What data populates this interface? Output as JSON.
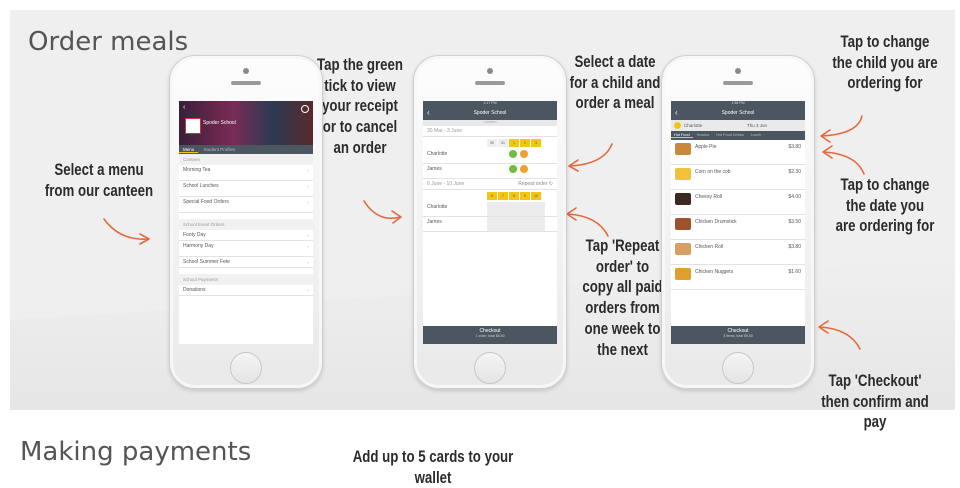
{
  "sections": {
    "order_heading": "Order meals",
    "payments_heading": "Making payments",
    "payments_caption": "Add up to 5 cards to your wallet"
  },
  "annotations": {
    "select_menu": "Select a menu\nfrom our canteen",
    "green_tick": "Tap the green\ntick to view\nyour receipt\nor to cancel\nan order",
    "select_date": "Select a date\nfor a child and\norder a meal",
    "repeat_order": "Tap 'Repeat\norder' to\ncopy all paid\norders from\none week to\nthe next",
    "change_child": "Tap to change\nthe child you are\nordering for",
    "change_date": "Tap to change\nthe date you\nare ordering for",
    "checkout": "Tap 'Checkout'\nthen confirm and pay"
  },
  "phone1": {
    "school_name": "Spoder School",
    "tabs": [
      "Menu",
      "Student Profiles"
    ],
    "section_canteen": "Canteen",
    "canteen_items": [
      "Morning Tea",
      "School Lunches",
      "Special Food Orders"
    ],
    "section_events": "School Event Orders",
    "event_items": [
      "Footy Day",
      "Harmony Day",
      "School Summer Fete"
    ],
    "section_payments": "School Payments",
    "payment_items": [
      "Donations"
    ]
  },
  "phone2": {
    "status_time": "2:17 PM",
    "title": "Spoder School",
    "subtitle": "Canteen",
    "week1": "30 Mar - 3 June",
    "week2": "6 June - 10 June",
    "students": [
      "Charlotte",
      "James"
    ],
    "repeat_label": "Repeat order",
    "checkout_label": "Checkout",
    "checkout_sub": "1 order, total $8.50"
  },
  "phone3": {
    "status_time": "1:58 PM",
    "title": "Spoder School",
    "child": "Charlotte",
    "date": "Thu 3 Jun",
    "tabs": [
      "Hot Food",
      "Snacks",
      "Hot Food Drinks",
      "Lunch"
    ],
    "foods": [
      {
        "name": "Apple Pie",
        "price": "$3.80"
      },
      {
        "name": "Corn on the cob",
        "price": "$2.30"
      },
      {
        "name": "Cheesy Roll",
        "price": "$4.00"
      },
      {
        "name": "Chicken Drumstick",
        "price": "$3.50"
      },
      {
        "name": "Chicken Roll",
        "price": "$3.80"
      },
      {
        "name": "Chicken Nuggets",
        "price": "$1.60"
      }
    ],
    "checkout_label": "Checkout",
    "checkout_sub": "3 items, total $9.80"
  },
  "colors": {
    "arrow": "#e46a3a",
    "brand_yellow": "#f3c614",
    "nav": "#4c5660",
    "green_tick": "#6cbf3f",
    "orange_cancel": "#f0a030"
  }
}
